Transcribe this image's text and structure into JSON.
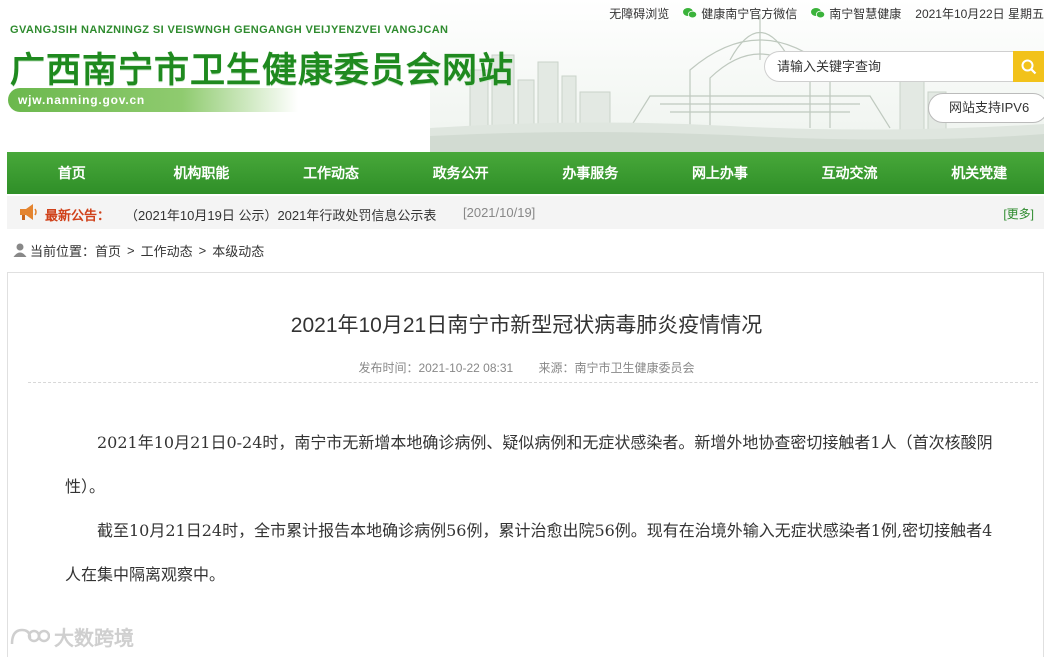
{
  "topbar": {
    "accessible": "无障碍浏览",
    "wechat": "健康南宁官方微信",
    "smart_health": "南宁智慧健康",
    "date": "2021年10月22日 星期五"
  },
  "site": {
    "pinyin": "GVANGJSIH NANZNINGZ SI VEISWNGH GENGANGH VEIJYENZVEI VANGJCAN",
    "title": "广西南宁市卫生健康委员会网站",
    "domain": "wjw.nanning.gov.cn"
  },
  "search": {
    "placeholder": "请输入关键字查询"
  },
  "ipv6": "网站支持IPV6",
  "nav": [
    "首页",
    "机构职能",
    "工作动态",
    "政务公开",
    "办事服务",
    "网上办事",
    "互动交流",
    "机关党建"
  ],
  "notice": {
    "label": "最新公告：",
    "text": "（2021年10月19日 公示）2021年行政处罚信息公示表",
    "date": "[2021/10/19]",
    "more": "[更多]"
  },
  "breadcrumb": {
    "prefix": "当前位置：",
    "items": [
      "首页",
      "工作动态",
      "本级动态"
    ],
    "sep": ">"
  },
  "article": {
    "title": "2021年10月21日南宁市新型冠状病毒肺炎疫情情况",
    "publish_time": "发布时间：2021-10-22 08:31",
    "source": "来源：南宁市卫生健康委员会",
    "paragraphs": [
      "2021年10月21日0-24时，南宁市无新增本地确诊病例、疑似病例和无症状感染者。新增外地协查密切接触者1人（首次核酸阴性）。",
      "截至10月21日24时，全市累计报告本地确诊病例56例，累计治愈出院56例。现有在治境外输入无症状感染者1例,密切接触者4人在集中隔离观察中。"
    ]
  },
  "watermark": "大数跨境",
  "colors": {
    "nav_green": "#2f8f28",
    "title_green": "#1f8a1f",
    "notice_red": "#d0421b",
    "search_yellow": "#f2c21a"
  }
}
